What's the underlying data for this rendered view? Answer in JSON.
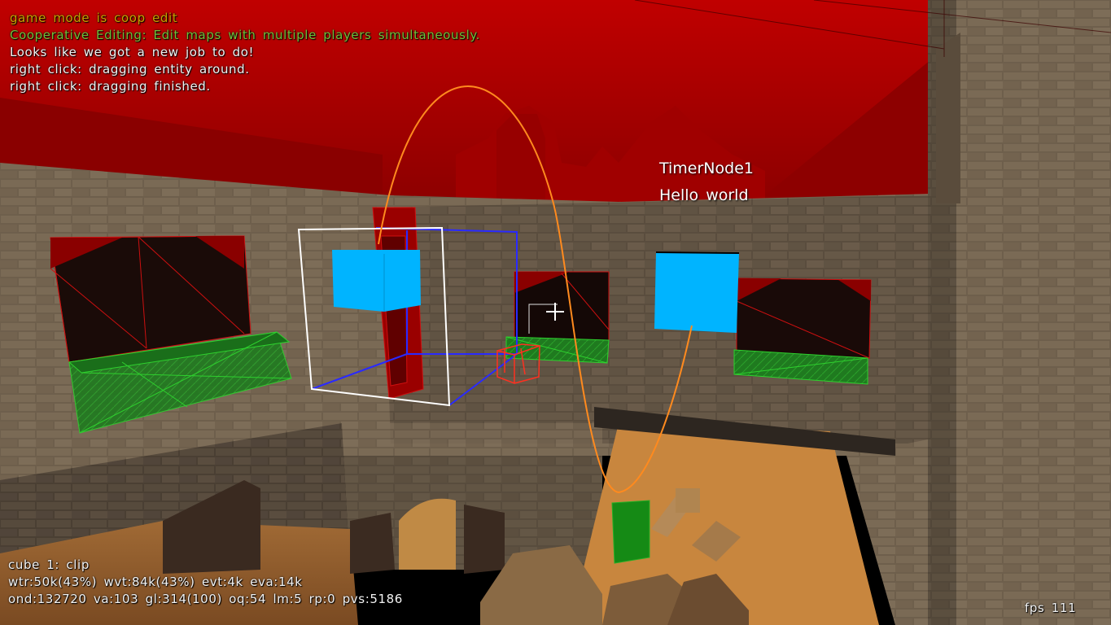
{
  "console": {
    "lines": [
      {
        "text": "game mode is coop edit",
        "color": "#c8a000"
      },
      {
        "text": "Cooperative Editing: Edit maps with multiple players simultaneously.",
        "color": "#6fbf3a"
      },
      {
        "text": "Looks like we got a new job to do!",
        "color": "#f2f2f2"
      },
      {
        "text": "right click: dragging entity around.",
        "color": "#f2f2f2"
      },
      {
        "text": "right click: dragging finished.",
        "color": "#f2f2f2"
      }
    ]
  },
  "world_labels": {
    "entity_name": "TimerNode1",
    "entity_message": "Hello world"
  },
  "stats": {
    "line1": "cube 1: clip",
    "line2": "wtr:50k(43%) wvt:84k(43%) evt:4k eva:14k",
    "line3": "ond:132720 va:103 gl:314(100) oq:54 lm:5 rp:0 pvs:5186"
  },
  "fps": "fps 111",
  "colors": {
    "sky": "#c00000",
    "entity_cube": "#00b4ff",
    "selection_box": "#ffffff",
    "selection_box_back": "#2222ff",
    "entity_link": "#ff8a1e",
    "clip_material": "#1f8a1f",
    "hovered_entity": "#ff3020"
  },
  "icons": {
    "crosshair": "crosshair-icon"
  }
}
